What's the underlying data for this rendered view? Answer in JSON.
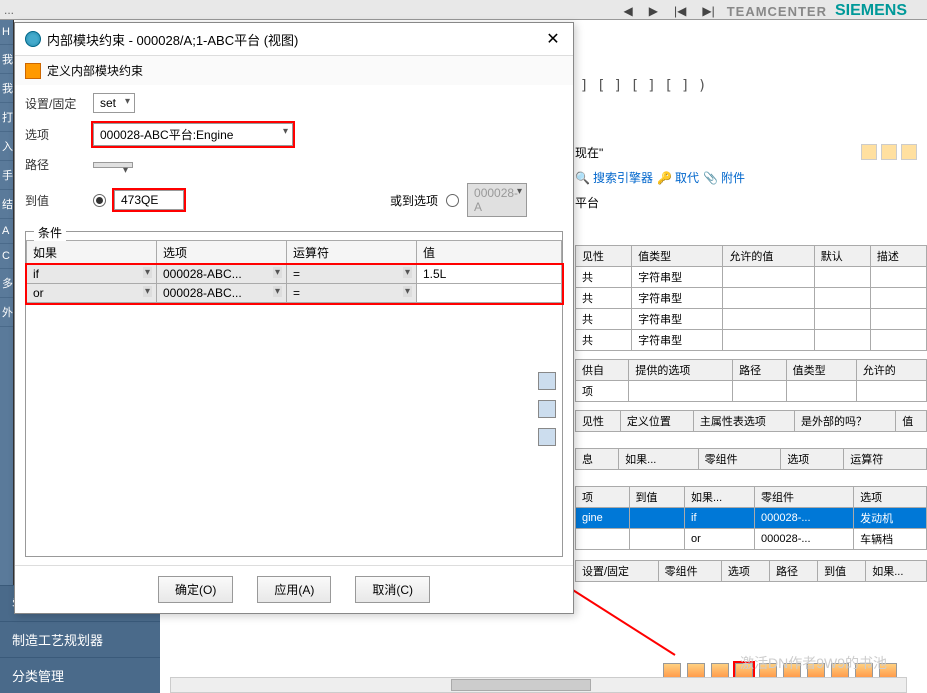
{
  "header": {
    "menu_fragments": "..."
  },
  "branding": {
    "teamcenter": "TEAMCENTER",
    "siemens": "SIEMENS"
  },
  "brackets": "] [ ] [ ] [  ] )",
  "bg_search": {
    "now_label": "现在\"",
    "search_engine": "搜索引擎器",
    "replace": "取代",
    "attachments": "附件",
    "platform": "平台"
  },
  "bg_tables": {
    "t1_headers": [
      "见性",
      "值类型",
      "允许的值",
      "默认",
      "描述"
    ],
    "t1_rows": [
      [
        "共",
        "字符串型",
        "",
        "",
        ""
      ],
      [
        "共",
        "字符串型",
        "",
        "",
        ""
      ],
      [
        "共",
        "字符串型",
        "",
        "",
        ""
      ],
      [
        "共",
        "字符串型",
        "",
        "",
        ""
      ]
    ],
    "t2_headers": [
      "供自",
      "提供的选项",
      "路径",
      "值类型",
      "允许的"
    ],
    "t2_row": [
      "项",
      "",
      "",
      "",
      ""
    ],
    "t3_headers": [
      "见性",
      "定义位置",
      "主属性表选项",
      "是外部的吗？",
      "值"
    ],
    "t4_headers": [
      "息",
      "如果...",
      "零组件",
      "选项",
      "运算符"
    ],
    "t5_headers": [
      "项",
      "到值",
      "如果...",
      "零组件",
      "选项"
    ],
    "t5_rows": [
      [
        "gine",
        "",
        "if",
        "000028-...",
        "发动机"
      ],
      [
        "",
        "",
        "or",
        "000028-...",
        "车辆档"
      ]
    ],
    "t6_headers": [
      "设置/固定",
      "零组件",
      "选项",
      "路径",
      "到值",
      "如果..."
    ]
  },
  "sidebar": {
    "items": [
      "H",
      "我",
      "我",
      "",
      "打",
      "入",
      "手",
      "",
      "结",
      "A",
      "C",
      "多",
      "外"
    ]
  },
  "bottom_nav": {
    "items": [
      "零件规划器",
      "制造工艺规划器",
      "分类管理"
    ]
  },
  "dialog": {
    "title": "内部模块约束 - 000028/A;1-ABC平台 (视图)",
    "subtitle": "定义内部模块约束",
    "set_label": "设置/固定",
    "set_value": "set",
    "option_label": "选项",
    "option_value": "000028-ABC平台:Engine",
    "path_label": "路径",
    "tovalue_label": "到值",
    "tovalue_input": "473QE",
    "or_option_label": "或到选项",
    "or_option_value": "000028-A",
    "conditions_legend": "条件",
    "cond_headers": [
      "如果",
      "选项",
      "运算符",
      "值"
    ],
    "cond_rows": [
      {
        "if": "if",
        "option": "000028-ABC...",
        "op": "=",
        "value": "1.5L"
      },
      {
        "if": "or",
        "option": "000028-ABC...",
        "op": "=",
        "value": ""
      }
    ],
    "btn_ok": "确定(O)",
    "btn_apply": "应用(A)",
    "btn_cancel": "取消(C)"
  },
  "watermark": "激活DN作者9W9的书池"
}
